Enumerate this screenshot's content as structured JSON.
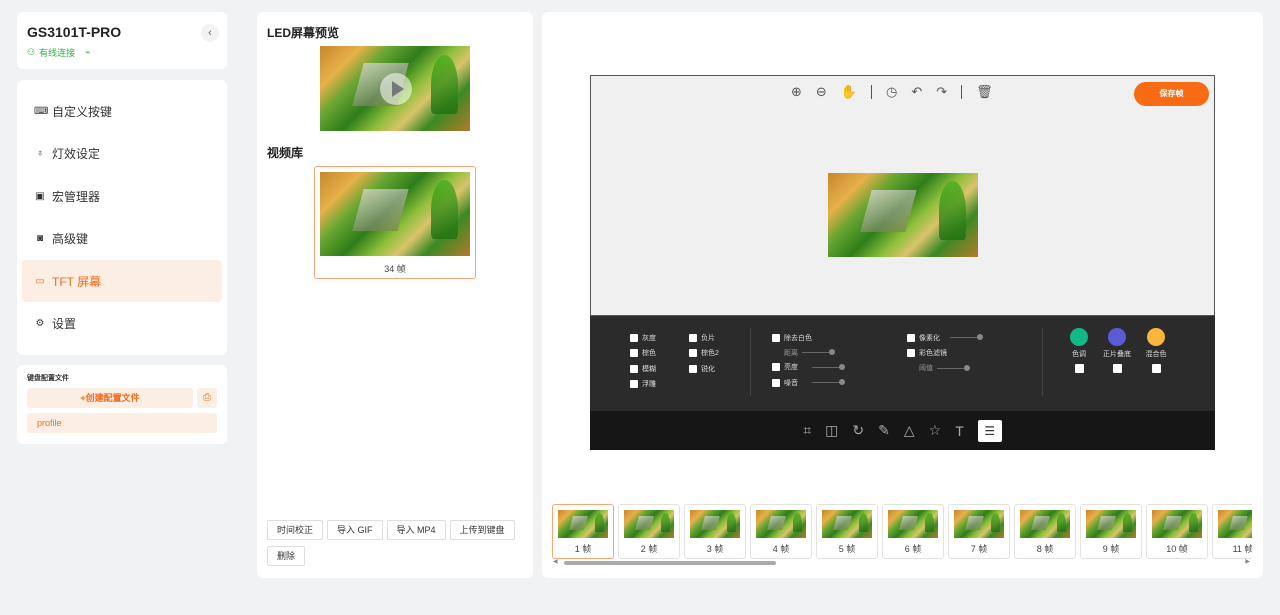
{
  "device": {
    "name": "GS3101T-PRO",
    "collapse_icon": "‹",
    "connection": "有线连接",
    "connection_color": "#2fb344"
  },
  "nav": {
    "items": [
      {
        "label": "自定义按键",
        "icon": "keyboard-icon"
      },
      {
        "label": "灯效设定",
        "icon": "bulb-icon"
      },
      {
        "label": "宏管理器",
        "icon": "macro-icon"
      },
      {
        "label": "高级键",
        "icon": "advanced-key-icon"
      },
      {
        "label": "TFT 屏幕",
        "icon": "monitor-icon",
        "active": true
      },
      {
        "label": "设置",
        "icon": "gear-icon"
      }
    ],
    "active_color": "#f26b1d"
  },
  "profiles": {
    "title": "键盘配置文件",
    "create_label": "+创建配置文件",
    "items": [
      "profile"
    ]
  },
  "middle": {
    "preview_title": "LED屏幕预览",
    "library_title": "视频库",
    "video_frames": "34 帧",
    "buttons": [
      "时间校正",
      "导入 GIF",
      "导入 MP4",
      "上传到键盘",
      "删除"
    ]
  },
  "editor": {
    "save_label": "保存帧",
    "save_color": "#f96a14",
    "filters": {
      "col1": [
        "灰度",
        "棕色",
        "模糊",
        "浮雕"
      ],
      "col2": [
        "负片",
        "棕色2",
        "锐化"
      ],
      "col3": {
        "remove_white": "除去白色",
        "distance": "距离",
        "brightness": "亮度",
        "noise": "噪音"
      },
      "col4": {
        "pixelate": "像素化",
        "color_filter": "彩色滤镜",
        "threshold": "阈值"
      },
      "colors": [
        {
          "label": "色调",
          "color": "#12b886"
        },
        {
          "label": "正片叠底",
          "color": "#5b5bd6"
        },
        {
          "label": "混合色",
          "color": "#fab53c"
        }
      ]
    },
    "frames": [
      "1 帧",
      "2 帧",
      "3 帧",
      "4 帧",
      "5 帧",
      "6 帧",
      "7 帧",
      "8 帧",
      "9 帧",
      "10 帧",
      "11 帧"
    ]
  }
}
